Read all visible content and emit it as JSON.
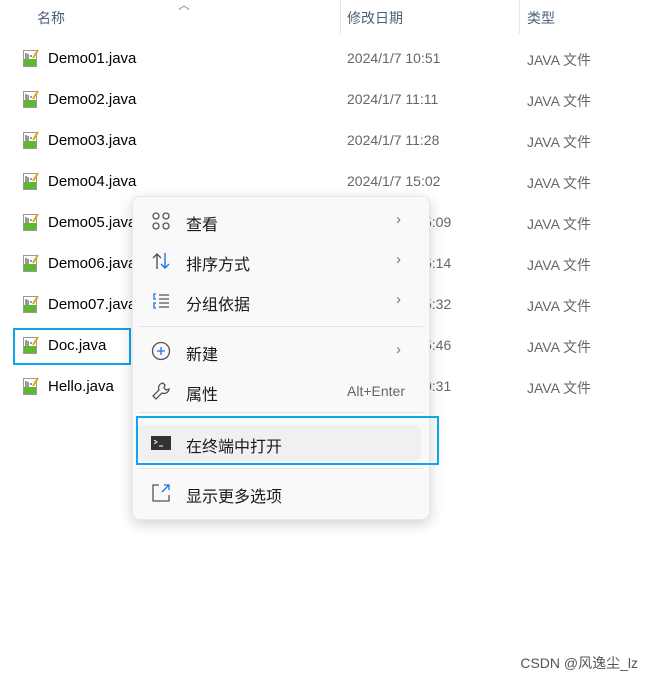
{
  "header": {
    "name": "名称",
    "date": "修改日期",
    "type": "类型"
  },
  "files": [
    {
      "name": "Demo01.java",
      "date": "2024/1/7 10:51",
      "type": "JAVA 文件"
    },
    {
      "name": "Demo02.java",
      "date": "2024/1/7 11:11",
      "type": "JAVA 文件"
    },
    {
      "name": "Demo03.java",
      "date": "2024/1/7 11:28",
      "type": "JAVA 文件"
    },
    {
      "name": "Demo04.java",
      "date": "2024/1/7 15:02",
      "type": "JAVA 文件"
    },
    {
      "name": "Demo05.java",
      "date_partial": "5:09",
      "type": "JAVA 文件"
    },
    {
      "name": "Demo06.java",
      "date_partial": "5:14",
      "type": "JAVA 文件"
    },
    {
      "name": "Demo07.java",
      "date_partial": "5:32",
      "type": "JAVA 文件"
    },
    {
      "name": "Doc.java",
      "date_partial": "5:46",
      "type": "JAVA 文件",
      "selected": true
    },
    {
      "name": "Hello.java",
      "date_partial": "0:31",
      "type": "JAVA 文件"
    }
  ],
  "menu": {
    "items": [
      {
        "label": "查看",
        "icon": "grid-view-icon",
        "submenu": true
      },
      {
        "label": "排序方式",
        "icon": "sort-arrows-icon",
        "submenu": true
      },
      {
        "label": "分组依据",
        "icon": "group-list-icon",
        "submenu": true
      },
      {
        "label": "新建",
        "icon": "plus-circle-icon",
        "submenu": true
      },
      {
        "label": "属性",
        "icon": "wrench-icon",
        "shortcut": "Alt+Enter"
      },
      {
        "label": "在终端中打开",
        "icon": "terminal-icon",
        "highlighted": true
      },
      {
        "label": "显示更多选项",
        "icon": "external-link-icon"
      }
    ],
    "chevron": "›"
  },
  "watermark": "CSDN @风逸尘_lz",
  "colors": {
    "accent": "#0ea5e9"
  }
}
